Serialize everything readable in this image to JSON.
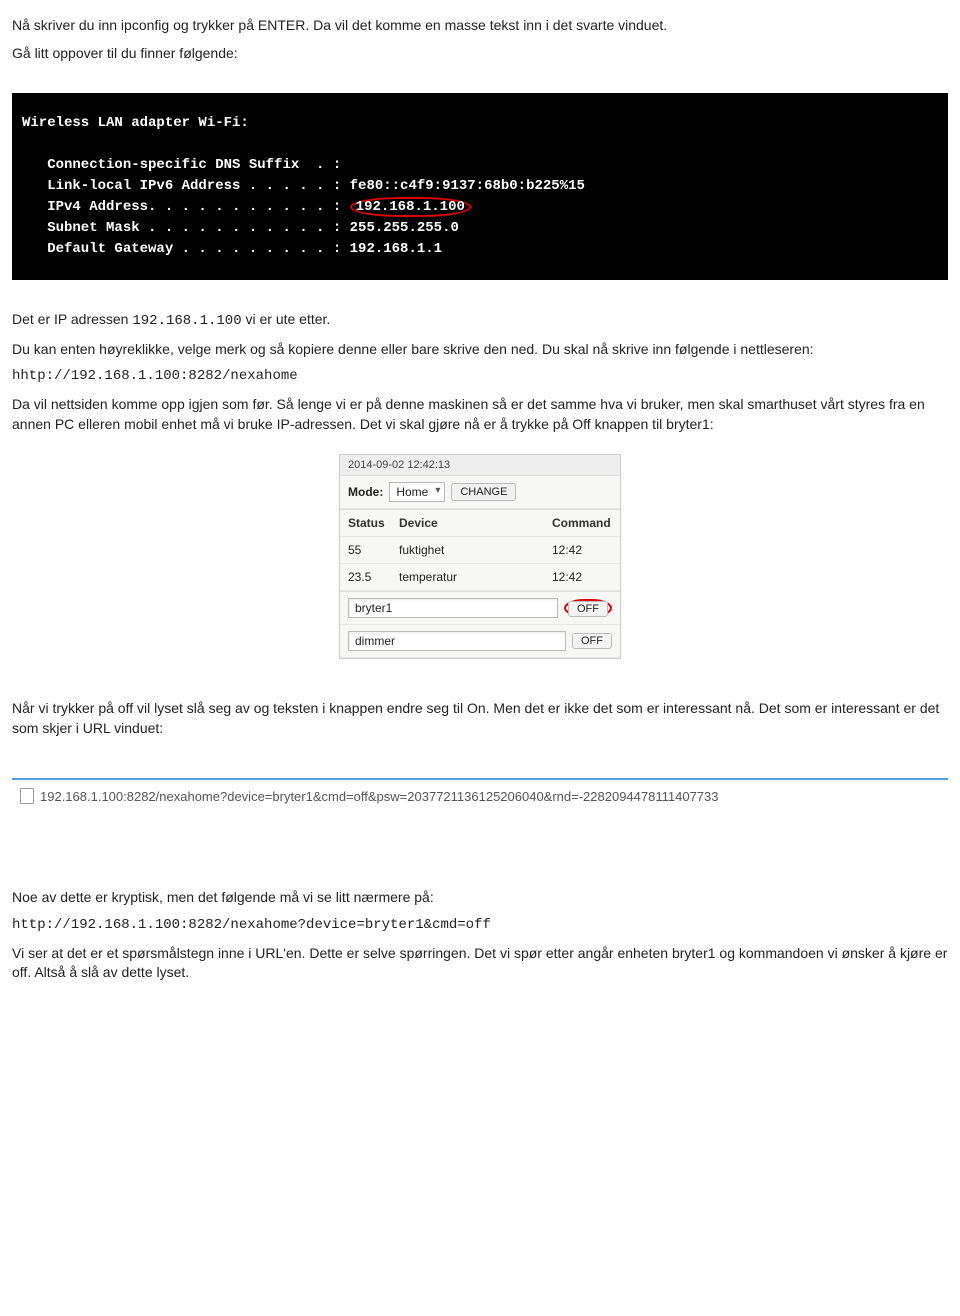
{
  "intro": {
    "p1": "Nå skriver du inn ipconfig og trykker på ENTER. Da vil det komme en masse tekst inn i det svarte vinduet.",
    "p2": "Gå litt oppover til du finner følgende:"
  },
  "terminal": {
    "header": "Wireless LAN adapter Wi-Fi:",
    "rows": {
      "dns": "   Connection-specific DNS Suffix  . :",
      "ipv6": "   Link-local IPv6 Address . . . . . : fe80::c4f9:9137:68b0:b225%15",
      "ipv4l": "   IPv4 Address. . . . . . . . . . . :",
      "ipv4v": "192.168.1.100",
      "mask": "   Subnet Mask . . . . . . . . . . . : 255.255.255.0",
      "gw": "   Default Gateway . . . . . . . . . : 192.168.1.1"
    }
  },
  "after_terminal": {
    "p1a": "Det er IP adressen ",
    "p1b": "192.168.1.100",
    "p1c": " vi er ute etter.",
    "p2": "Du kan enten høyreklikke, velge merk og så kopiere denne eller bare skrive den ned. Du skal nå skrive inn følgende i nettleseren:",
    "code": "hhtp://192.168.1.100:8282/nexahome",
    "p3": "Da vil nettsiden komme opp igjen som før. Så lenge vi er på denne maskinen så er det samme hva vi bruker, men skal smarthuset vårt styres fra en annen PC elleren mobil enhet må vi bruke IP-adressen. Det vi skal gjøre nå er å trykke på Off knappen til bryter1:"
  },
  "nexa": {
    "timestamp": "2014-09-02 12:42:13",
    "mode_label": "Mode:",
    "mode_value": "Home",
    "change_label": "CHANGE",
    "columns": {
      "status": "Status",
      "device": "Device",
      "command": "Command"
    },
    "rows": {
      "r1": {
        "status": "55",
        "device": "fuktighet",
        "command": "12:42"
      },
      "r2": {
        "status": "23.5",
        "device": "temperatur",
        "command": "12:42"
      }
    },
    "inputs": {
      "bryter1": "bryter1",
      "dimmer": "dimmer"
    },
    "off_label": "OFF"
  },
  "after_nexa": {
    "p1": "Når vi trykker på off vil lyset slå seg av og teksten i knappen endre seg til On. Men det er ikke det som er interessant nå. Det som er interessant er det som skjer i URL vinduet:"
  },
  "url_bar": {
    "url": "192.168.1.100:8282/nexahome?device=bryter1&cmd=off&psw=2037721136125206040&rnd=-2282094478111407733"
  },
  "closing": {
    "p1": "Noe av dette er kryptisk, men det følgende må vi se litt nærmere på:",
    "code": "http://192.168.1.100:8282/nexahome?device=bryter1&cmd=off",
    "p2": "Vi ser at det er et spørsmålstegn inne i URL'en. Dette er selve spørringen. Det vi spør etter angår enheten bryter1 og kommandoen vi ønsker å kjøre er off. Altså å slå av dette lyset."
  }
}
